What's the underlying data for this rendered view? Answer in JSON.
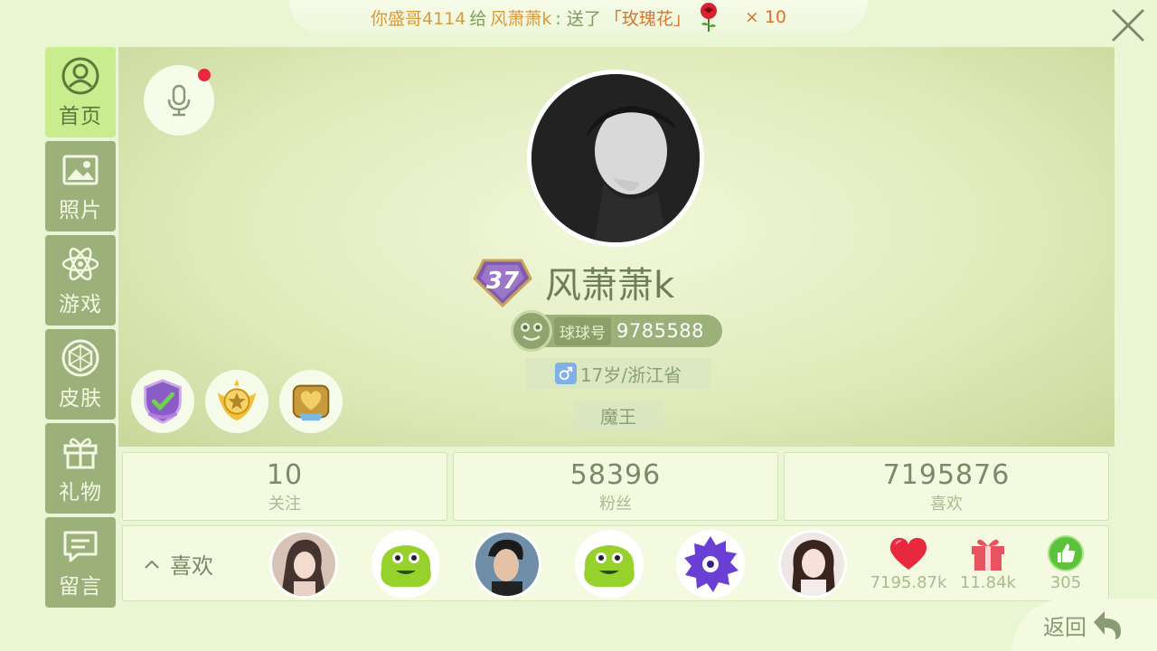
{
  "banner": {
    "sender": "你盛哥4114",
    "verb": "给",
    "receiver": "风萧萧k",
    "message": ": 送了",
    "gift": "「玫瑰花」",
    "count": "× 10"
  },
  "sidebar": {
    "items": [
      {
        "label": "首页",
        "icon": "user-circle-icon",
        "active": true
      },
      {
        "label": "照片",
        "icon": "image-icon",
        "active": false
      },
      {
        "label": "游戏",
        "icon": "atom-icon",
        "active": false
      },
      {
        "label": "皮肤",
        "icon": "diamond-ring-icon",
        "active": false
      },
      {
        "label": "礼物",
        "icon": "gift-icon",
        "active": false
      },
      {
        "label": "留言",
        "icon": "message-icon",
        "active": false
      }
    ]
  },
  "profile": {
    "level": "37",
    "name": "风萧萧k",
    "id_label": "球球号",
    "id_value": "9785588",
    "info": "17岁/浙江省",
    "title": "魔王"
  },
  "stats": [
    {
      "value": "10",
      "label": "关注"
    },
    {
      "value": "58396",
      "label": "粉丝"
    },
    {
      "value": "7195876",
      "label": "喜欢"
    }
  ],
  "likes": {
    "label": "喜欢",
    "metrics": [
      {
        "icon": "heart-icon",
        "value": "7195.87k"
      },
      {
        "icon": "gift-icon",
        "value": "11.84k"
      },
      {
        "icon": "thumbs-up-icon",
        "value": "305"
      }
    ]
  },
  "back": {
    "label": "返回"
  },
  "colors": {
    "accent": "#c9ec8e",
    "sidebar": "#9cb07a",
    "heart": "#e8283e",
    "gift": "#e8535f",
    "thumb": "#5cc23c"
  }
}
